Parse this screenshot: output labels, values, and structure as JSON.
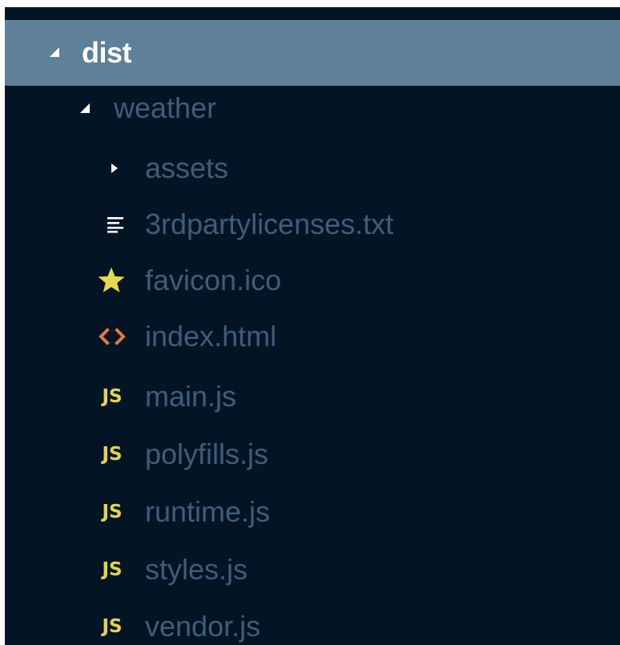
{
  "tree": {
    "root": {
      "label": "dist",
      "expanded": true,
      "selected": true,
      "icon": "caret-expanded-icon"
    },
    "folder": {
      "label": "weather",
      "expanded": true,
      "icon": "caret-expanded-icon"
    },
    "items": [
      {
        "label": "assets",
        "icon": "caret-collapsed-icon",
        "type": "folder"
      },
      {
        "label": "3rdpartylicenses.txt",
        "icon": "text-file-icon",
        "type": "file"
      },
      {
        "label": "favicon.ico",
        "icon": "star-icon",
        "type": "file"
      },
      {
        "label": "index.html",
        "icon": "html-code-icon",
        "type": "file"
      },
      {
        "label": "main.js",
        "icon": "js-icon",
        "icon_text": "JS",
        "type": "file"
      },
      {
        "label": "polyfills.js",
        "icon": "js-icon",
        "icon_text": "JS",
        "type": "file"
      },
      {
        "label": "runtime.js",
        "icon": "js-icon",
        "icon_text": "JS",
        "type": "file"
      },
      {
        "label": "styles.js",
        "icon": "js-icon",
        "icon_text": "JS",
        "type": "file"
      },
      {
        "label": "vendor.js",
        "icon": "js-icon",
        "icon_text": "JS",
        "type": "file"
      }
    ]
  },
  "colors": {
    "background": "#031425",
    "selected_row": "#5f8099",
    "label_text": "#3f5d7a",
    "selected_text": "#ffffff",
    "js_icon": "#e3d54a",
    "star_icon": "#e8d84a",
    "html_icon": "#e07b3c",
    "caret": "#ffffff"
  }
}
